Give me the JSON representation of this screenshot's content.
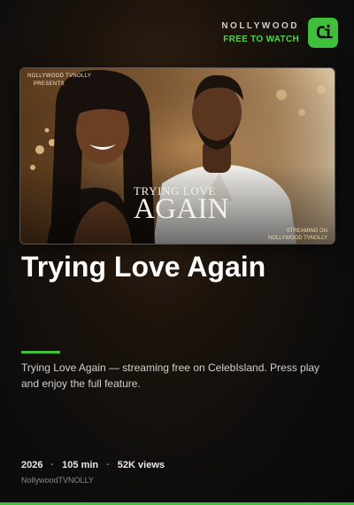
{
  "brand": {
    "name": "NOLLYWOOD",
    "tagline": "FREE TO WATCH",
    "logo_letters": "Ci",
    "accent_color": "#3fbf3a"
  },
  "poster": {
    "publisher_line1": "NOLLYWOOD TVNOLLY",
    "publisher_line2": "PRESENTS",
    "title_line1": "TRYING LOVE",
    "title_line2": "AGAIN",
    "streaming_label": "STREAMING ON",
    "streaming_channel": "NOLLYWOOD TVNOLLY"
  },
  "movie": {
    "title": "Trying Love Again",
    "description": "Trying Love Again — streaming free on CelebIsland. Press play and enjoy the full feature.",
    "year": "2026",
    "duration": "105 min",
    "views": "52K views",
    "channel": "NollywoodTVNOLLY"
  }
}
